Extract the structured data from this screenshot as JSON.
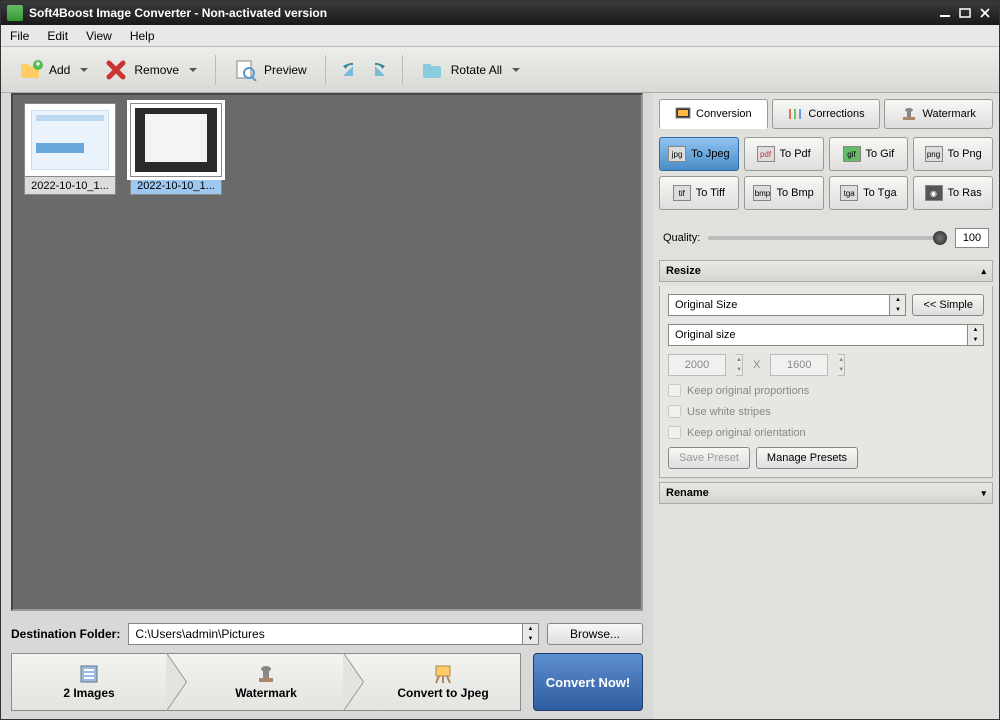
{
  "window": {
    "title": "Soft4Boost Image Converter - Non-activated version"
  },
  "menu": {
    "file": "File",
    "edit": "Edit",
    "view": "View",
    "help": "Help"
  },
  "toolbar": {
    "add": "Add",
    "remove": "Remove",
    "preview": "Preview",
    "rotate_all": "Rotate All"
  },
  "thumbs": [
    {
      "label": "2022-10-10_1..."
    },
    {
      "label": "2022-10-10_1..."
    }
  ],
  "dest": {
    "label": "Destination Folder:",
    "path": "C:\\Users\\admin\\Pictures",
    "browse": "Browse..."
  },
  "steps": {
    "s1": "2 Images",
    "s2": "Watermark",
    "s3": "Convert to Jpeg",
    "convert": "Convert Now!"
  },
  "tabs": {
    "conversion": "Conversion",
    "corrections": "Corrections",
    "watermark": "Watermark"
  },
  "formats": {
    "jpeg": "To Jpeg",
    "pdf": "To Pdf",
    "gif": "To Gif",
    "png": "To Png",
    "tiff": "To Tiff",
    "bmp": "To Bmp",
    "tga": "To Tga",
    "ras": "To Ras"
  },
  "quality": {
    "label": "Quality:",
    "value": "100"
  },
  "resize": {
    "header": "Resize",
    "preset": "Original Size",
    "mode": "Original size",
    "simple": "<< Simple",
    "w": "2000",
    "h": "1600",
    "x": "X",
    "keep_prop": "Keep original proportions",
    "white_stripes": "Use white stripes",
    "keep_orient": "Keep original orientation",
    "save_preset": "Save Preset",
    "manage_presets": "Manage Presets"
  },
  "rename": {
    "header": "Rename"
  }
}
